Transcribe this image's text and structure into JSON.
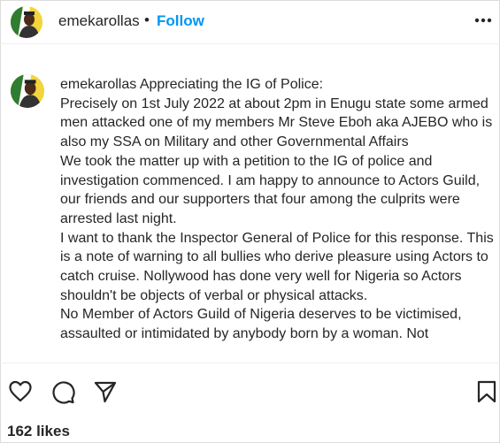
{
  "post": {
    "username": "emekarollas",
    "follow_label": "Follow",
    "separator": "•",
    "more_icon": "more-options-icon"
  },
  "caption": {
    "username": "emekarollas",
    "lines": [
      "Appreciating the IG of Police:",
      "Precisely on 1st July 2022 at about 2pm in Enugu state some armed men attacked one of my members Mr Steve Eboh aka AJEBO who is also my SSA on Military and other Governmental Affairs",
      "We took the matter up with a petition to the IG of police and investigation commenced. I am happy to announce to Actors Guild, our friends and our supporters that four among the culprits were arrested last night.",
      "I want to thank the Inspector General of Police for this response. This is a note of warning to all bullies who derive pleasure using Actors to catch cruise. Nollywood has done very well for Nigeria so Actors shouldn't be objects of verbal or physical attacks.",
      "No Member of Actors Guild of Nigeria deserves to be victimised, assaulted or intimidated by anybody born by a woman. Not"
    ]
  },
  "actions": {
    "like_icon": "heart-icon",
    "comment_icon": "comment-icon",
    "share_icon": "share-icon",
    "save_icon": "bookmark-icon"
  },
  "likes": "162 likes",
  "colors": {
    "accent": "#0095f6",
    "text": "#262626",
    "avatar_bg": "#f2d53c"
  }
}
